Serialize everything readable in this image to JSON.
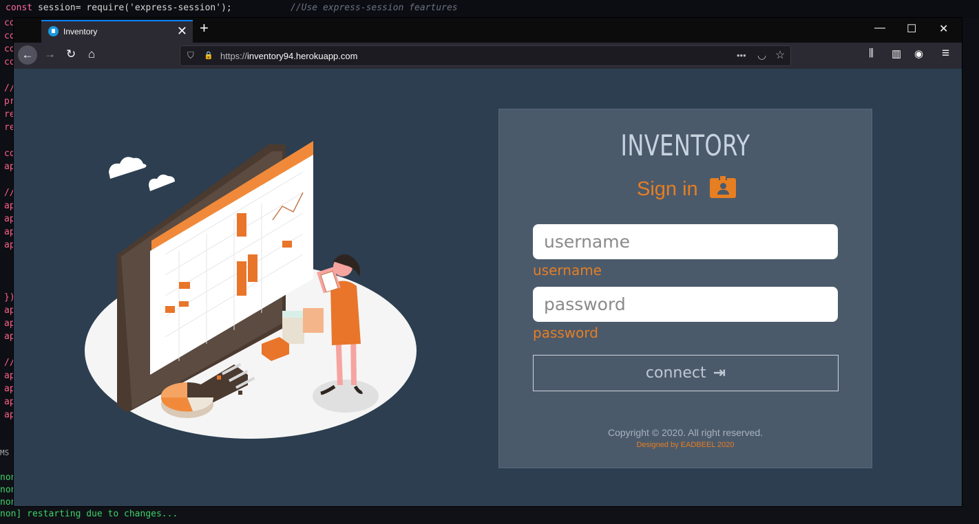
{
  "editor": {
    "code_line": "const session= require('express-session');",
    "comment_line": "//Use express-session feartures",
    "gutter_lines": [
      "co",
      "co",
      "co",
      "co",
      "",
      "//",
      "pr",
      "re",
      "re",
      "",
      "co",
      "ap",
      "",
      "//",
      "ap",
      "ap",
      "ap",
      "ap",
      "",
      "",
      "",
      "})",
      "ap",
      "ap",
      "ap",
      "",
      "//",
      "ap",
      "ap",
      "ap",
      "ap"
    ]
  },
  "terminal": {
    "ms_label": "MS",
    "lines": [
      "non]",
      "non]",
      "non]",
      "non] restarting due to changes..."
    ]
  },
  "browser": {
    "tab_title": "Inventory",
    "tab_close": "✕",
    "new_tab": "+",
    "window_controls": {
      "minimize": "—",
      "maximize": "☐",
      "close": "✕"
    },
    "nav": {
      "back": "←",
      "forward": "→",
      "reload": "↻",
      "home": "⌂"
    },
    "url_prefix": "https://",
    "url_host": "inventory94.herokuapp.com",
    "url_icons": {
      "shield": "⛉",
      "lock": "🔒",
      "more": "•••",
      "pocket": "◡",
      "star": "☆"
    },
    "toolbar_icons": {
      "library": "⫼",
      "sidebar": "▥",
      "account": "◉",
      "menu": "≡"
    }
  },
  "login": {
    "title": "INVENTORY",
    "signin": "Sign in",
    "username_placeholder": "username",
    "username_label": "username",
    "password_placeholder": "password",
    "password_label": "password",
    "connect": "connect",
    "connect_icon": "⇥",
    "copyright": "Copyright © 2020. All right reserved.",
    "designed_by": "Designed by EADBEEL 2020"
  },
  "colors": {
    "accent": "#e67e22",
    "page_bg": "#2c3e50",
    "card_bg": "#4b5a6b"
  }
}
